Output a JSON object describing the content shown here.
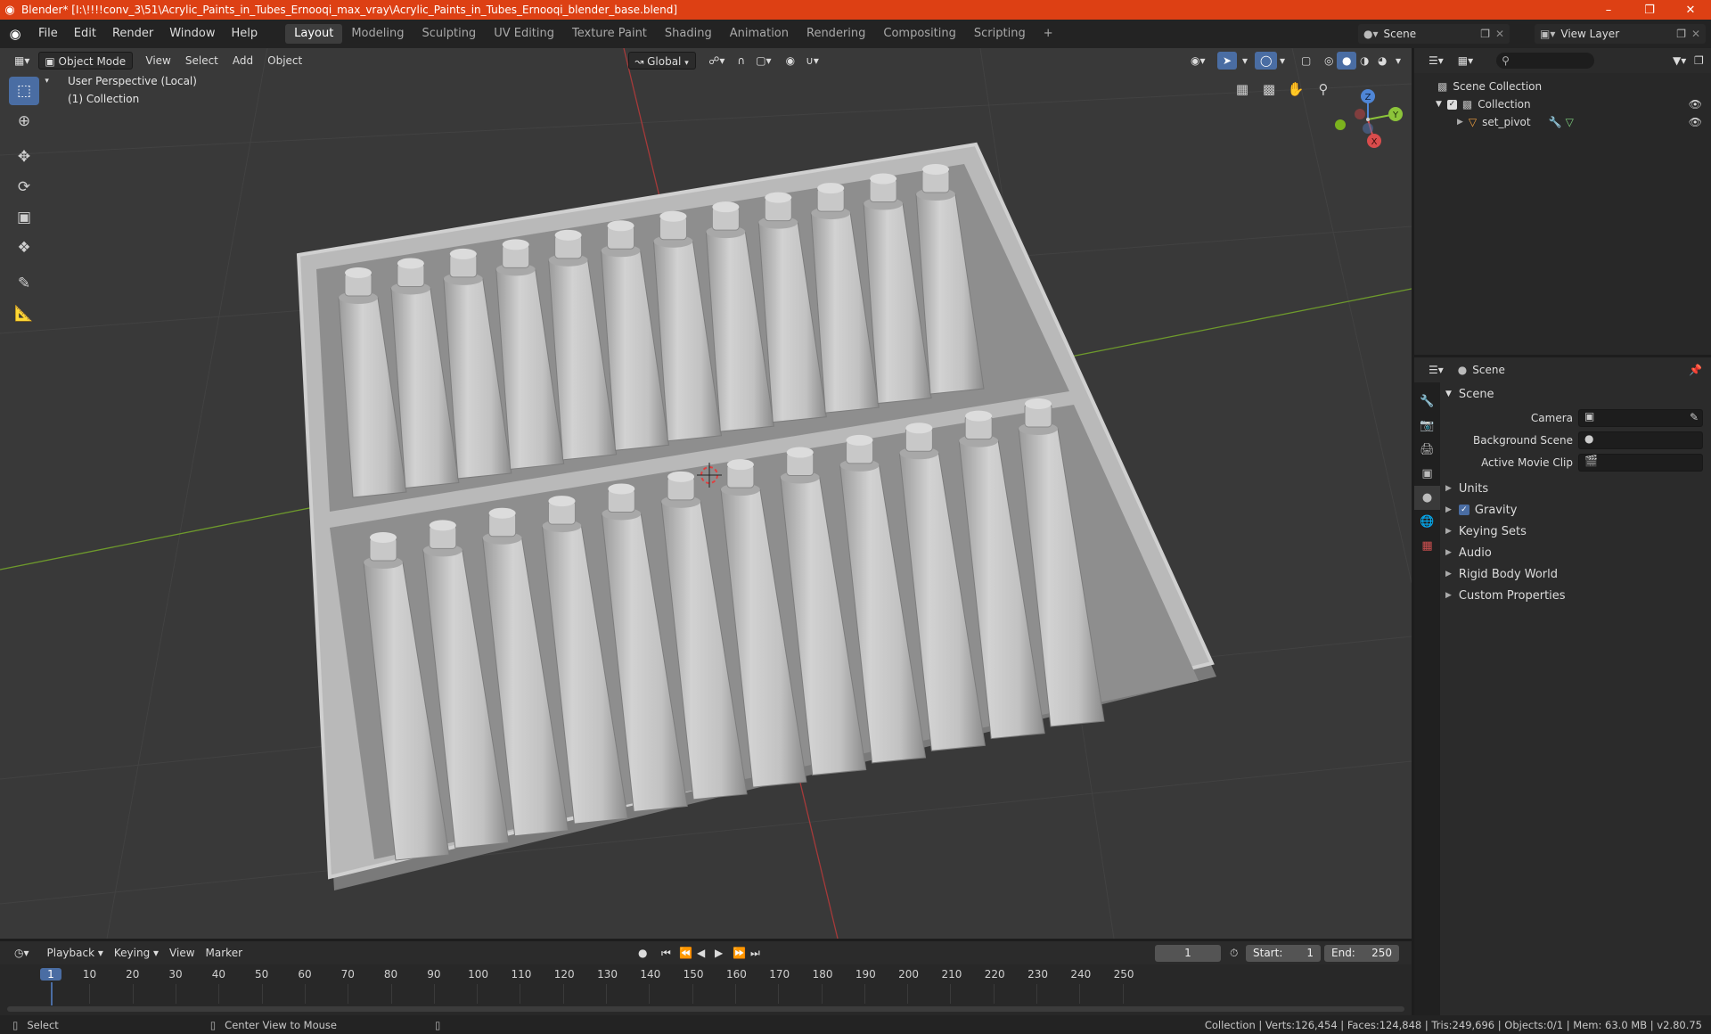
{
  "window": {
    "title": "Blender* [I:\\!!!!conv_3\\51\\Acrylic_Paints_in_Tubes_Ernooqi_max_vray\\Acrylic_Paints_in_Tubes_Ernooqi_blender_base.blend]",
    "minimize": "–",
    "maximize": "❐",
    "close": "✕"
  },
  "menubar": {
    "menus": [
      "File",
      "Edit",
      "Render",
      "Window",
      "Help"
    ],
    "workspaces": [
      "Layout",
      "Modeling",
      "Sculpting",
      "UV Editing",
      "Texture Paint",
      "Shading",
      "Animation",
      "Rendering",
      "Compositing",
      "Scripting"
    ],
    "active_workspace": "Layout",
    "add_tab": "+",
    "scene": "Scene",
    "view_layer": "View Layer"
  },
  "viewport": {
    "mode": "Object Mode",
    "menus": [
      "View",
      "Select",
      "Add",
      "Object"
    ],
    "transform_orientation": "Global",
    "info_line1": "User Perspective (Local)",
    "info_line2": "(1) Collection",
    "gizmo": {
      "z": "Z",
      "y": "Y",
      "x": "X"
    }
  },
  "outliner": {
    "search_placeholder": "",
    "root": "Scene Collection",
    "collection": "Collection",
    "object": "set_pivot"
  },
  "properties": {
    "context": "Scene",
    "panel": "Scene",
    "fields": [
      {
        "label": "Camera",
        "value": ""
      },
      {
        "label": "Background Scene",
        "value": ""
      },
      {
        "label": "Active Movie Clip",
        "value": ""
      }
    ],
    "subpanels": [
      "Units",
      "Gravity",
      "Keying Sets",
      "Audio",
      "Rigid Body World",
      "Custom Properties"
    ],
    "gravity_checked": true
  },
  "timeline": {
    "menus": [
      "Playback",
      "Keying",
      "View",
      "Marker"
    ],
    "current_frame": "1",
    "start_label": "Start:",
    "start": "1",
    "end_label": "End:",
    "end": "250",
    "ticks": [
      "1",
      "10",
      "20",
      "30",
      "40",
      "50",
      "60",
      "70",
      "80",
      "90",
      "100",
      "110",
      "120",
      "130",
      "140",
      "150",
      "160",
      "170",
      "180",
      "190",
      "200",
      "210",
      "220",
      "230",
      "240",
      "250"
    ]
  },
  "statusbar": {
    "select": "Select",
    "center_view": "Center View to Mouse",
    "stats": "Collection | Verts:126,454 | Faces:124,848 | Tris:249,696 | Objects:0/1 | Mem: 63.0 MB | v2.80.75"
  },
  "colors": {
    "titlebar": "#dd4014",
    "accent": "#4a6da3",
    "viewport_bg": "#393939",
    "x_axis": "#d94c4c",
    "y_axis": "#8cc43a",
    "z_axis": "#4f86d6"
  }
}
